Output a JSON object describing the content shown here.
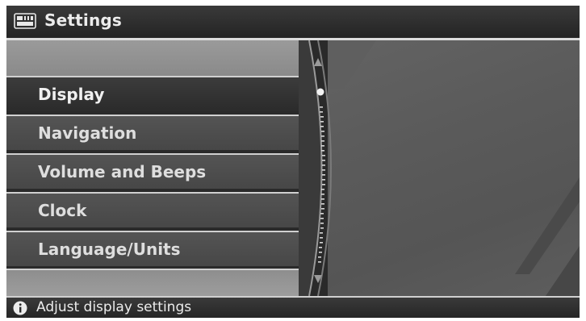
{
  "header": {
    "title": "Settings",
    "icon": "settings-screen-icon"
  },
  "menu": {
    "items": [
      {
        "label": "Display",
        "selected": true
      },
      {
        "label": "Navigation",
        "selected": false
      },
      {
        "label": "Volume and Beeps",
        "selected": false
      },
      {
        "label": "Clock",
        "selected": false
      },
      {
        "label": "Language/Units",
        "selected": false
      }
    ]
  },
  "status": {
    "icon": "info-icon",
    "text": "Adjust display settings"
  },
  "colors": {
    "background": "#2a2a2a",
    "menu_item": "#4e4e4e",
    "menu_selected": "#333333",
    "separator": "#d0d0d0",
    "text": "#f0f0f0"
  }
}
